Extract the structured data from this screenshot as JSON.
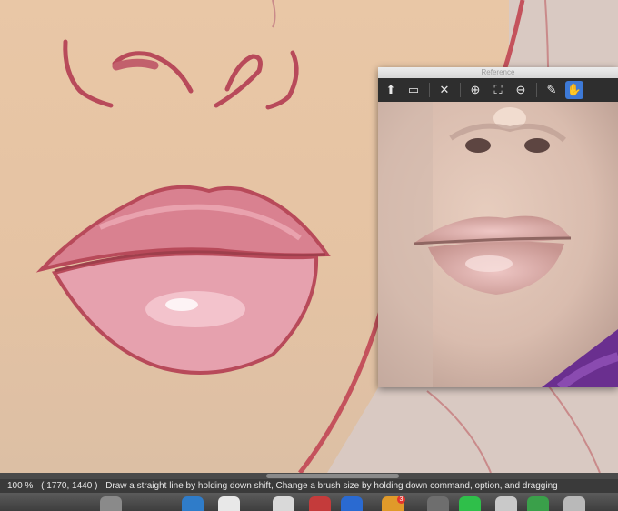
{
  "reference_window": {
    "title": "Reference",
    "toolbar": [
      {
        "name": "upload-icon",
        "glyph": "⬆"
      },
      {
        "name": "folder-icon",
        "glyph": "▭"
      },
      {
        "name": "close-icon",
        "glyph": "✕"
      },
      {
        "name": "zoom-in-icon",
        "glyph": "⊕"
      },
      {
        "name": "fit-icon",
        "glyph": "⛶"
      },
      {
        "name": "zoom-out-icon",
        "glyph": "⊖"
      },
      {
        "name": "eyedropper-icon",
        "glyph": "✎"
      },
      {
        "name": "hand-icon",
        "glyph": "✋"
      }
    ]
  },
  "status": {
    "zoom": "100 %",
    "coordinates": "( 1770, 1440 )",
    "hint": "Draw a straight line by holding down shift, Change a brush size by holding down command, option, and dragging"
  },
  "dock": {
    "badge_count": "3",
    "icons": [
      "app-icon",
      "app-icon",
      "app-icon",
      "app-icon",
      "app-icon",
      "app-icon",
      "app-icon",
      "app-icon",
      "app-icon",
      "app-icon"
    ]
  },
  "colors": {
    "canvas_skin": "#e9c7a6",
    "lip_outline": "#b84a5a",
    "accent_blue": "#3d79d6"
  }
}
